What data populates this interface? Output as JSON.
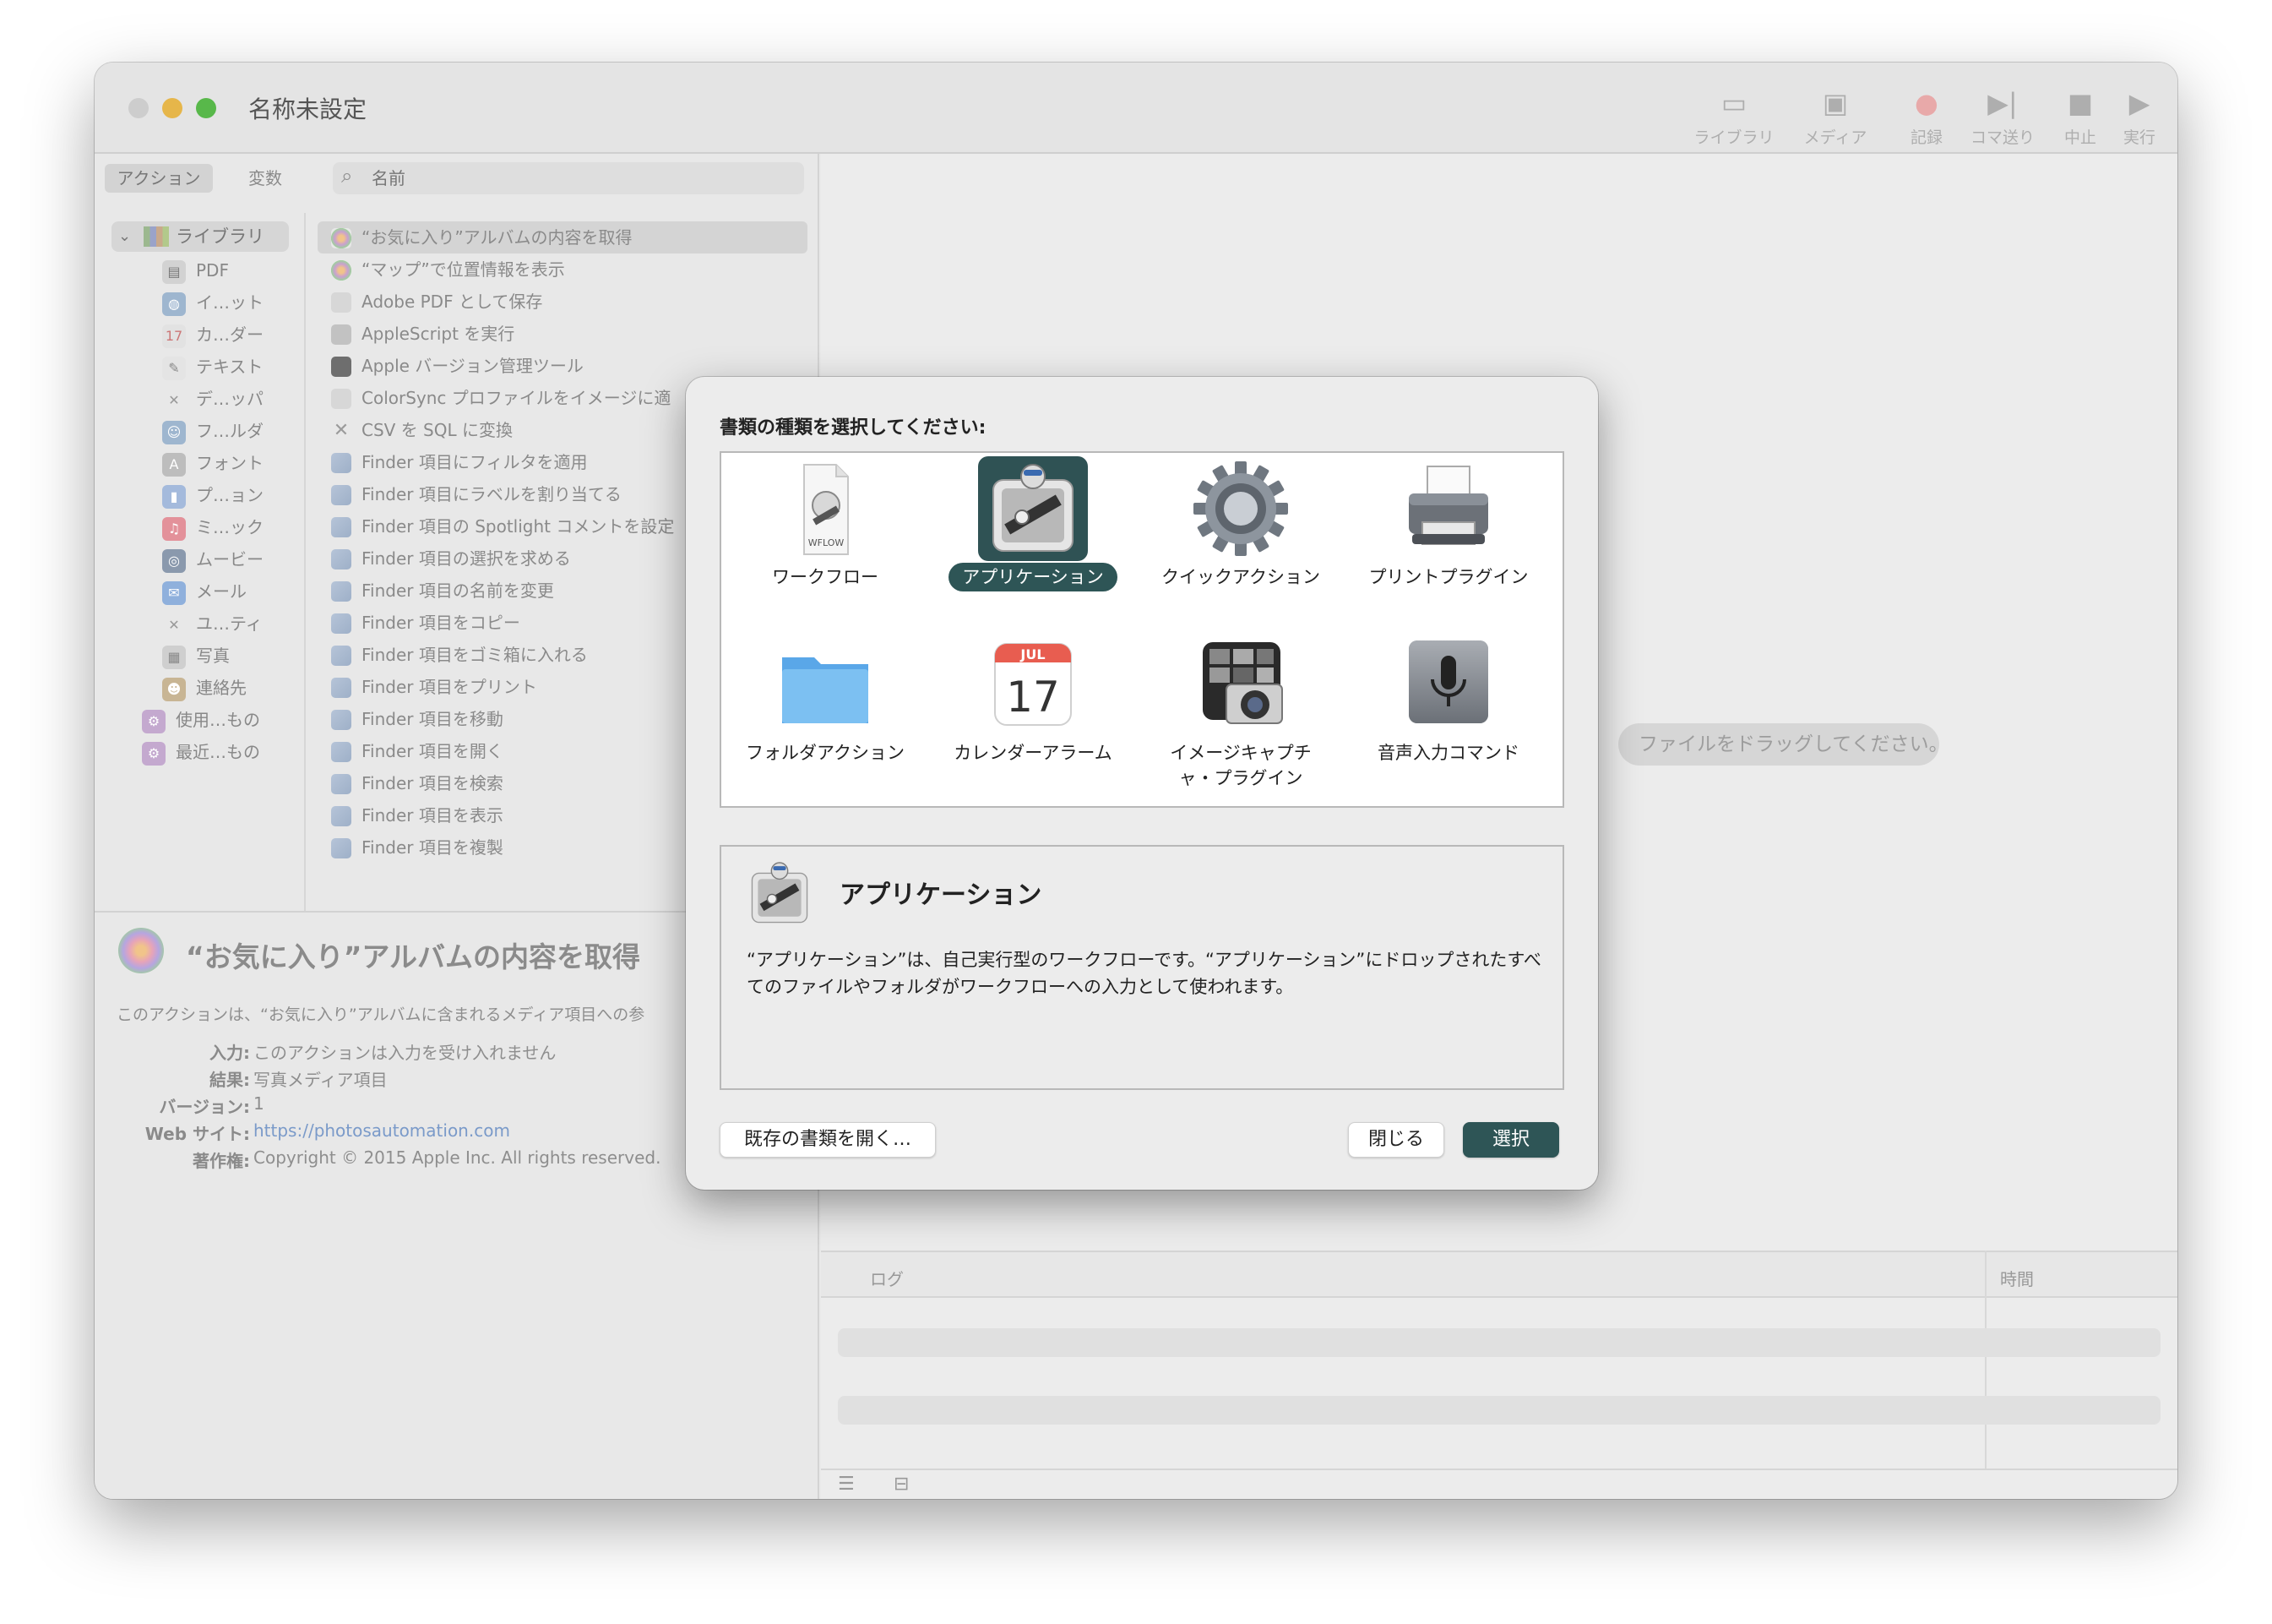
{
  "window": {
    "title": "名称未設定"
  },
  "toolbar": {
    "library": "ライブラリ",
    "media": "メディア",
    "record": "記録",
    "step": "コマ送り",
    "stop": "中止",
    "run": "実行"
  },
  "sidebar": {
    "tab_actions": "アクション",
    "tab_variables": "変数",
    "search_placeholder": "名前",
    "library_label": "ライブラリ",
    "categories": [
      "PDF",
      "イ…ット",
      "カ…ダー",
      "テキスト",
      "デ…ッパ",
      "フ…ルダ",
      "フォント",
      "プ…ョン",
      "ミ…ック",
      "ムービー",
      "メール",
      "ユ…ティ",
      "写真",
      "連絡先",
      "使用…もの",
      "最近…もの"
    ],
    "actions": [
      "“お気に入り”アルバムの内容を取得",
      "“マップ”で位置情報を表示",
      "Adobe PDF として保存",
      "AppleScript を実行",
      "Apple バージョン管理ツール",
      "ColorSync プロファイルをイメージに適",
      "CSV を SQL に変換",
      "Finder 項目にフィルタを適用",
      "Finder 項目にラベルを割り当てる",
      "Finder 項目の Spotlight コメントを設定",
      "Finder 項目の選択を求める",
      "Finder 項目の名前を変更",
      "Finder 項目をコピー",
      "Finder 項目をゴミ箱に入れる",
      "Finder 項目をプリント",
      "Finder 項目を移動",
      "Finder 項目を開く",
      "Finder 項目を検索",
      "Finder 項目を表示",
      "Finder 項目を複製"
    ]
  },
  "info": {
    "title": "“お気に入り”アルバムの内容を取得",
    "description": "このアクションは、“お気に入り”アルバムに含まれるメディア項目への参",
    "input_label": "入力:",
    "input_value": "このアクションは入力を受け入れません",
    "result_label": "結果:",
    "result_value": "写真メディア項目",
    "version_label": "バージョン:",
    "version_value": "1",
    "website_label": "Web サイト:",
    "website_value": "https://photosautomation.com",
    "copyright_label": "著作権:",
    "copyright_value": "Copyright © 2015 Apple Inc. All rights reserved."
  },
  "workflow": {
    "drop_hint": "ファイルをドラッグしてください。",
    "log_col": "ログ",
    "time_col": "時間"
  },
  "dialog": {
    "heading": "書類の種類を選択してください:",
    "types": [
      {
        "label": "ワークフロー",
        "icon": "wflow-document-icon"
      },
      {
        "label": "アプリケーション",
        "icon": "automator-robot-icon"
      },
      {
        "label": "クイックアクション",
        "icon": "gear-icon"
      },
      {
        "label": "プリントプラグイン",
        "icon": "printer-icon"
      },
      {
        "label": "フォルダアクション",
        "icon": "folder-icon"
      },
      {
        "label": "カレンダーアラーム",
        "icon": "calendar-icon"
      },
      {
        "label": "イメージキャプチャ・プラグイン",
        "icon": "image-capture-icon"
      },
      {
        "label": "音声入力コマンド",
        "icon": "microphone-icon"
      }
    ],
    "wflow_tag": "WFLOW",
    "calendar_month": "JUL",
    "calendar_day": "17",
    "selected_index": 1,
    "desc_title": "アプリケーション",
    "desc_text": "“アプリケーション”は、自己実行型のワークフローです。“アプリケーション”にドロップされたすべてのファイルやフォルダがワークフローへの入力として使われます。",
    "open_existing": "既存の書類を開く…",
    "close": "閉じる",
    "choose": "選択"
  },
  "colors": {
    "accent": "#2e5556",
    "dimmed_text": "#8e8e8e"
  }
}
